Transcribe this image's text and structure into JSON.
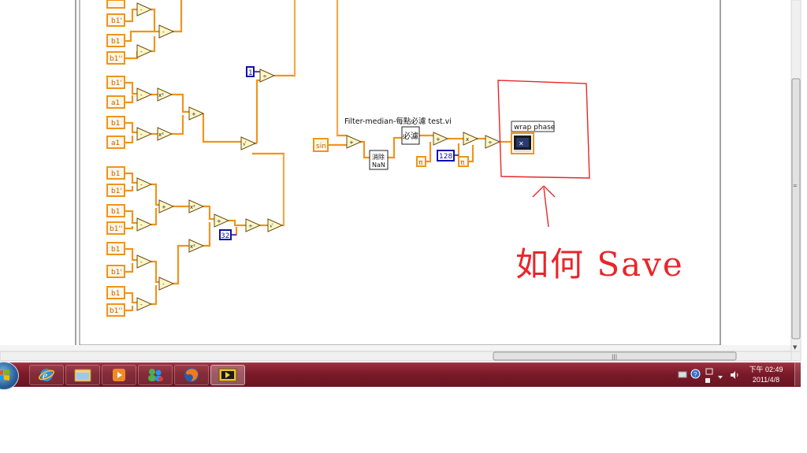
{
  "diagram": {
    "vi_label": "Filter-median-每點必濾 test.vi",
    "subvi_nan_line1": "消除",
    "subvi_nan_line2": "NaN",
    "subvi_filter": "必濾",
    "subvi_wrap_phase": "wrap phase",
    "input_sin": "sin",
    "const_1": "1",
    "const_32": "32",
    "const_128": "128",
    "const_pi": "π",
    "const_pi_2": "π",
    "annotation_text": "如何 Save",
    "terminals": [
      "b1'",
      "b1",
      "b1''",
      "b1'",
      "a1",
      "b1",
      "a1",
      "b1",
      "b1'",
      "b1",
      "b1''",
      "b1",
      "b1'",
      "b1",
      "b1''"
    ],
    "ops": [
      "+",
      "+",
      "x²",
      "+",
      "x²",
      "+",
      "x²",
      "+",
      "x²",
      "÷",
      "+",
      "x",
      "÷",
      "√",
      "÷",
      "√",
      "+",
      "√",
      "√"
    ]
  },
  "taskbar": {
    "apps": [
      "internet-explorer",
      "windows-explorer",
      "media-player",
      "messenger",
      "firefox",
      "labview"
    ],
    "clock_time": "下午 02:49",
    "clock_date": "2011/4/8"
  },
  "colors": {
    "wire_orange": "#f0941c",
    "wire_light": "#f6c27c",
    "const_blue": "#1010b0",
    "annotation_red": "#e8262a",
    "taskbar": "#7a1a28"
  }
}
